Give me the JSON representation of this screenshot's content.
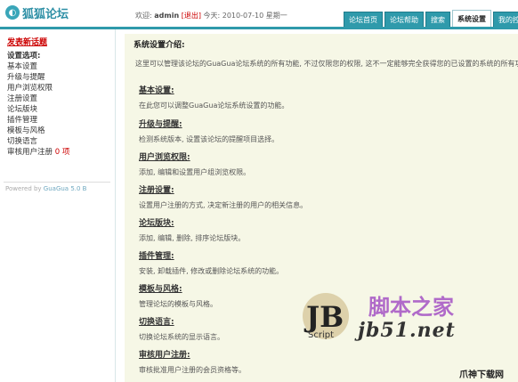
{
  "header": {
    "logo_text": "狐狐论坛",
    "user_prefix": "欢迎:",
    "username": "admin",
    "logout": "[退出]",
    "date": "今天: 2010-07-10 星期一",
    "tabs": [
      {
        "label": "论坛首页",
        "active": false
      },
      {
        "label": "论坛帮助",
        "active": false
      },
      {
        "label": "搜索",
        "active": false
      },
      {
        "label": "系统设置",
        "active": true
      },
      {
        "label": "我的控",
        "active": false
      }
    ]
  },
  "sidebar": {
    "post_link": "发表新话题",
    "items": [
      {
        "label": "设置选项:",
        "heading": true
      },
      {
        "label": "基本设置"
      },
      {
        "label": "升级与提醒"
      },
      {
        "label": "用户浏览权限"
      },
      {
        "label": "注册设置"
      },
      {
        "label": "论坛版块"
      },
      {
        "label": "插件管理"
      },
      {
        "label": "模板与风格"
      },
      {
        "label": "切换语言"
      },
      {
        "label": "审核用户注册",
        "badge": "0 项"
      }
    ],
    "powered": "Powered by ",
    "powered_link": "GuaGua 5.0 B"
  },
  "main": {
    "title": "系统设置介绍:",
    "intro": "这里可以管理该论坛的GuaGua论坛系统的所有功能, 不过仅限您的权限, 这不一定能够完全获得您的已设置的系统的所有功",
    "sections": [
      {
        "title": "基本设置:",
        "desc": "在此您可以调整GuaGua论坛系统设置的功能。"
      },
      {
        "title": "升级与提醒:",
        "desc": "检测系统版本, 设置该论坛的提醒项目选择。"
      },
      {
        "title": "用户浏览权限:",
        "desc": "添加, 编辑和设置用户组浏览权限。"
      },
      {
        "title": "注册设置:",
        "desc": "设置用户注册的方式, 决定新注册的用户的相关信息。"
      },
      {
        "title": "论坛版块:",
        "desc": "添加, 编辑, 删除, 排序论坛版块。"
      },
      {
        "title": "插件管理:",
        "desc": "安装, 卸载插件, 修改或删除论坛系统的功能。"
      },
      {
        "title": "模板与风格:",
        "desc": "管理论坛的模板与风格。"
      },
      {
        "title": "切换语言:",
        "desc": "切换论坛系统的显示语言。"
      },
      {
        "title": "审核用户注册:",
        "desc": "审核批准用户注册的会员资格等。"
      }
    ]
  },
  "watermark": {
    "logo_letters": "JB",
    "logo_script": "Script",
    "cn_text": "脚本之家",
    "url": "jb51.net",
    "corner": "爪神下载网"
  },
  "colors": {
    "accent": "#2f9aab",
    "main_bg": "#f6f7e6",
    "link_red": "#cc0000",
    "watermark_purple": "#b06ac9"
  }
}
